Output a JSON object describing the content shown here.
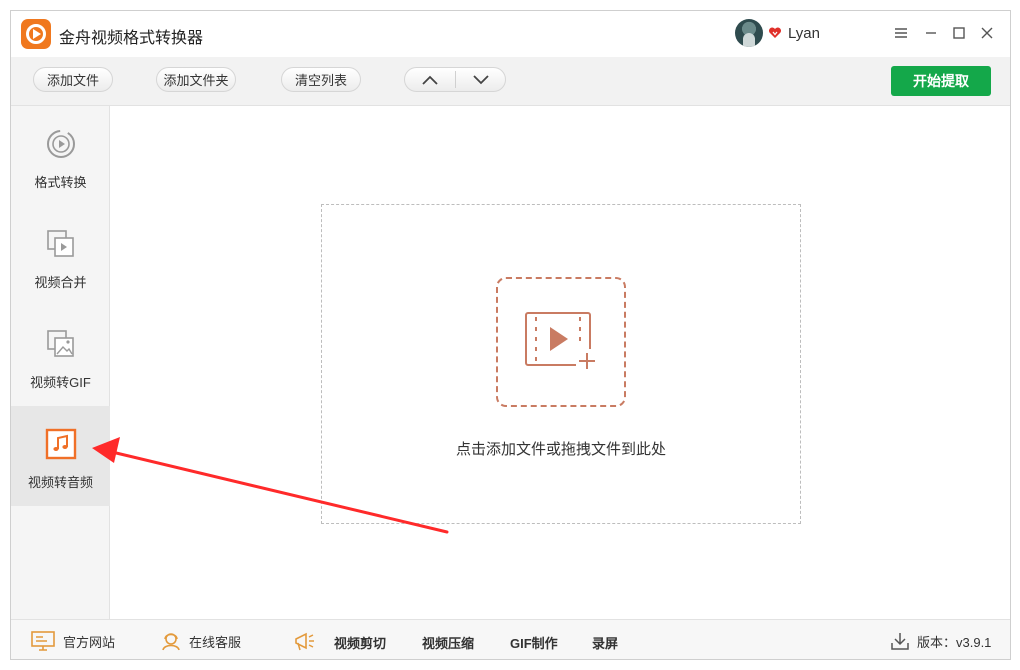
{
  "app": {
    "title": "金舟视频格式转换器"
  },
  "user": {
    "name": "Lyan"
  },
  "toolbar": {
    "add_file": "添加文件",
    "add_folder": "添加文件夹",
    "clear_list": "清空列表",
    "start": "开始提取"
  },
  "sidebar": {
    "items": [
      {
        "label": "格式转换",
        "icon": "play-circle-icon"
      },
      {
        "label": "视频合并",
        "icon": "merge-video-icon"
      },
      {
        "label": "视频转GIF",
        "icon": "image-icon"
      },
      {
        "label": "视频转音频",
        "icon": "music-note-icon"
      }
    ],
    "active_index": 3
  },
  "main": {
    "drop_hint": "点击添加文件或拖拽文件到此处"
  },
  "statusbar": {
    "website": "官方网站",
    "support": "在线客服",
    "tools": [
      "视频剪切",
      "视频压缩",
      "GIF制作",
      "录屏"
    ],
    "version": "版本：v3.9.1"
  },
  "colors": {
    "accent_green": "#14a84a",
    "brand_orange": "#f0781e",
    "active_icon_orange": "#f07028",
    "dropzone_icon": "#c97b62",
    "annotation_red": "#ff2a2a"
  }
}
